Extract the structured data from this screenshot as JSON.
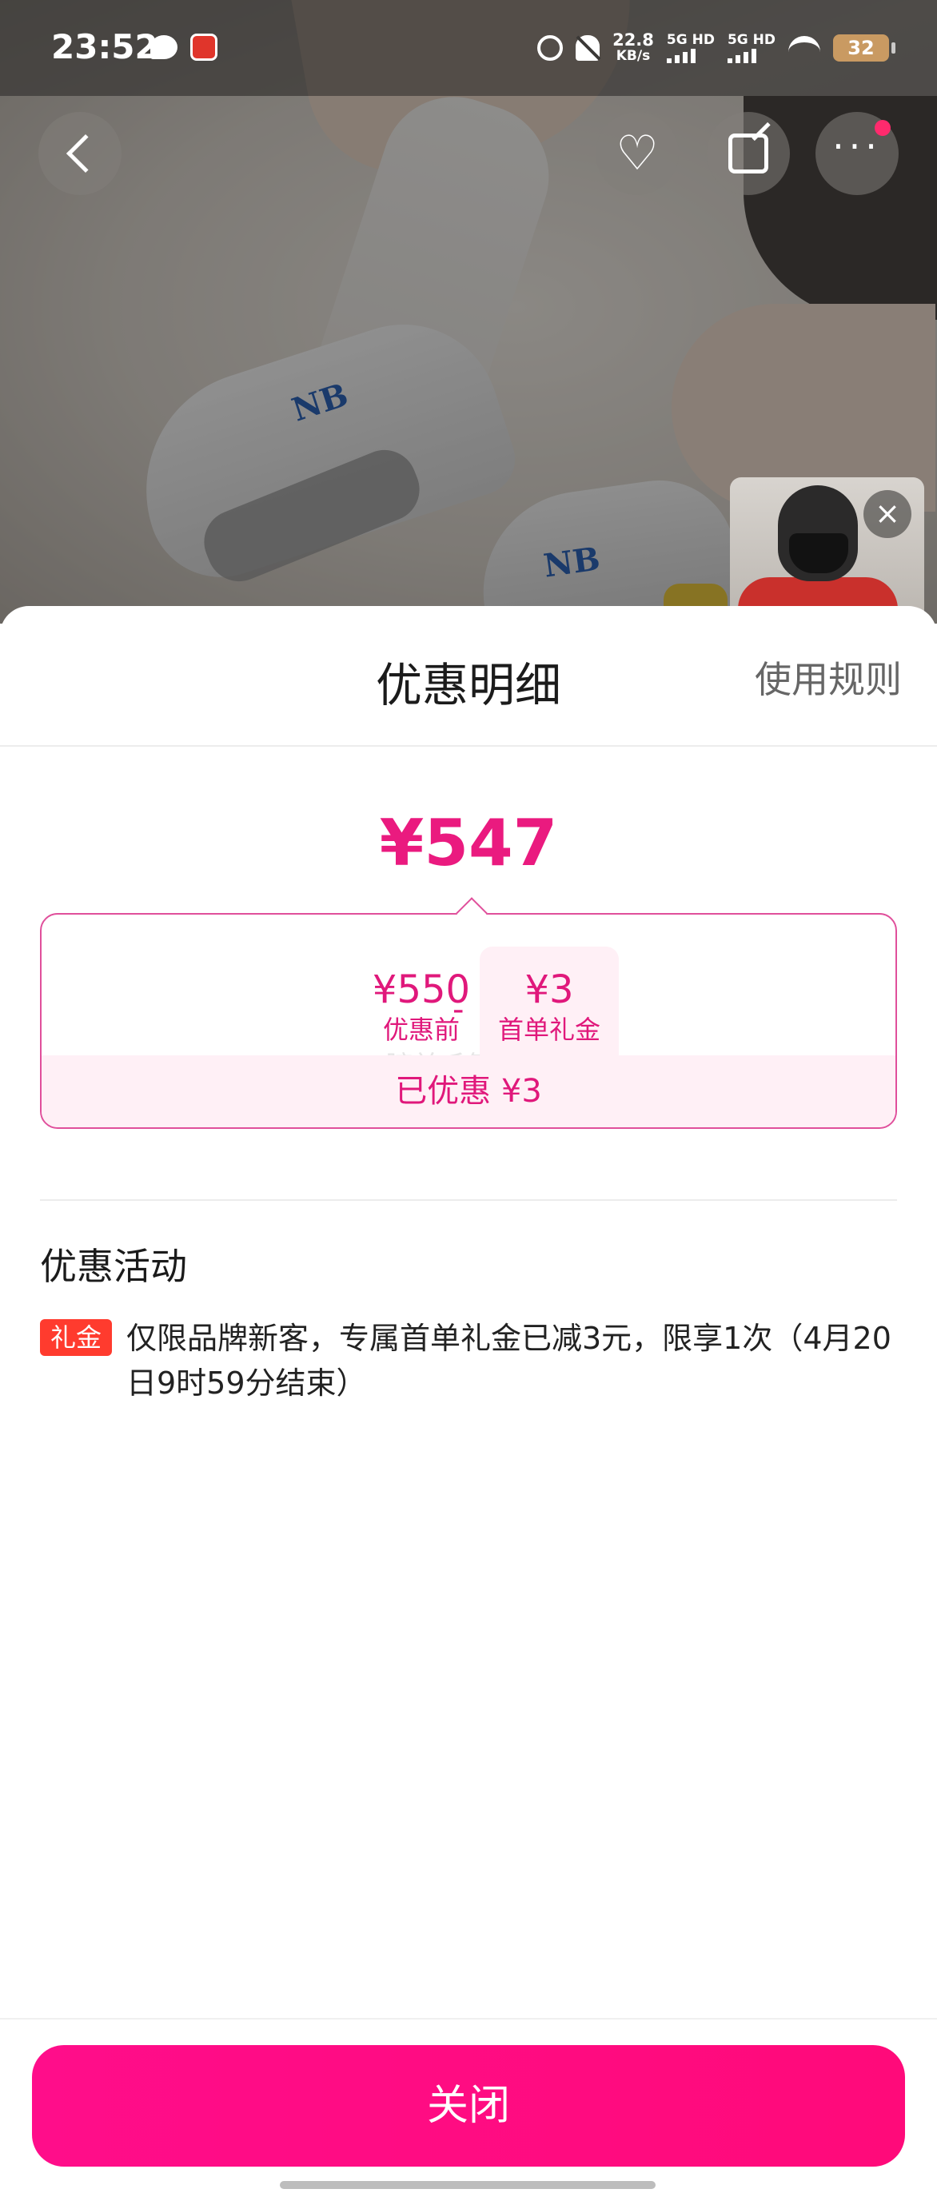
{
  "status_bar": {
    "time": "23:52",
    "net_speed_value": "22.8",
    "net_speed_unit": "KB/s",
    "sim1": "5G HD",
    "sim2": "5G HD",
    "battery": "32"
  },
  "product_photo": {
    "brand_mark": "NB"
  },
  "sheet": {
    "title": "优惠明细",
    "rules_link": "使用规则",
    "final_price": "¥547",
    "breakdown": {
      "original_price": "¥550",
      "original_label": "优惠前",
      "operator": "-",
      "coupon_amount": "¥3",
      "coupon_label": "首单礼金",
      "faded_text": "腑羊毛第一)",
      "saved_text": "已优惠 ¥3"
    },
    "promotions_title": "优惠活动",
    "promotions": [
      {
        "tag": "礼金",
        "text": "仅限品牌新客，专属首单礼金已减3元，限享1次（4月20日9时59分结束）"
      }
    ],
    "close_button": "关闭"
  },
  "colors": {
    "accent": "#ea1a7f",
    "close_button": "#ff0d8a",
    "tag": "#ff3b2e"
  }
}
